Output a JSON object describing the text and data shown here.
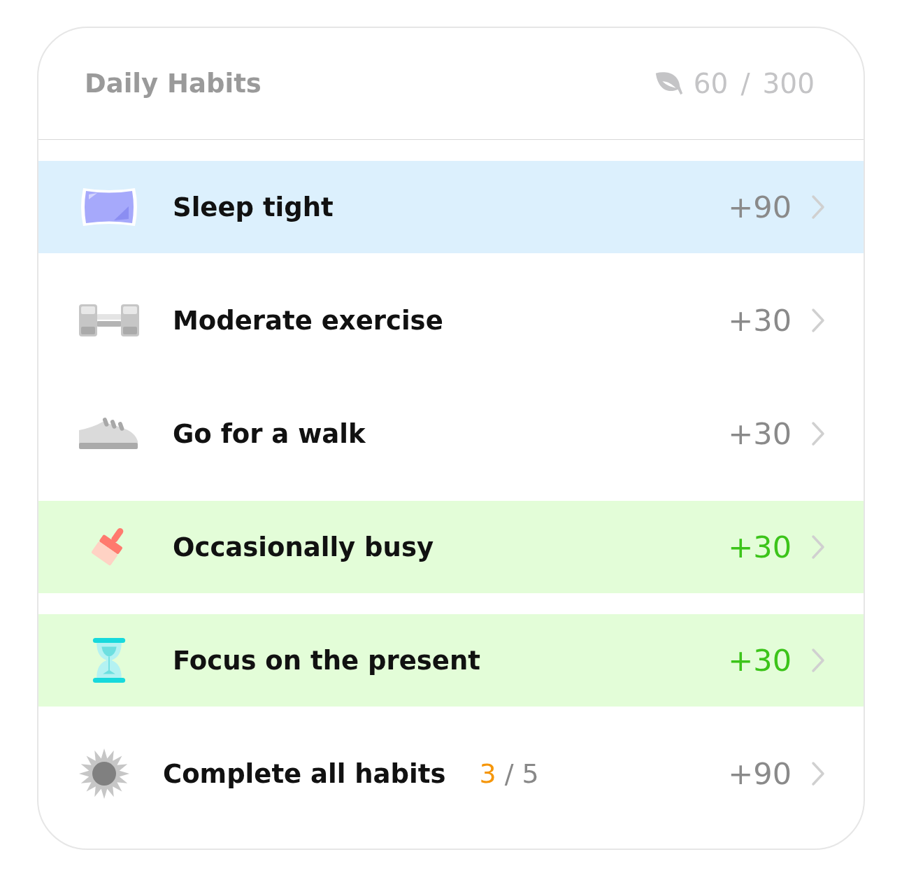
{
  "header": {
    "title": "Daily Habits",
    "earned": "60",
    "separator": "/",
    "total": "300"
  },
  "habits": [
    {
      "kind": "habit",
      "name": "Sleep tight",
      "points": "+90",
      "selected": true,
      "done": false
    },
    {
      "kind": "habit",
      "name": "Moderate exercise",
      "points": "+30",
      "selected": false,
      "done": false
    },
    {
      "kind": "habit",
      "name": "Go for a walk",
      "points": "+30",
      "selected": false,
      "done": false
    },
    {
      "kind": "habit",
      "name": "Occasionally busy",
      "points": "+30",
      "selected": false,
      "done": true
    },
    {
      "kind": "habit",
      "name": "Focus on the present",
      "points": "+30",
      "selected": false,
      "done": true
    },
    {
      "kind": "goal",
      "name": "Complete all habits",
      "progress": "3",
      "separator": "/",
      "target": "5",
      "points": "+90",
      "selected": false,
      "done": false
    }
  ]
}
